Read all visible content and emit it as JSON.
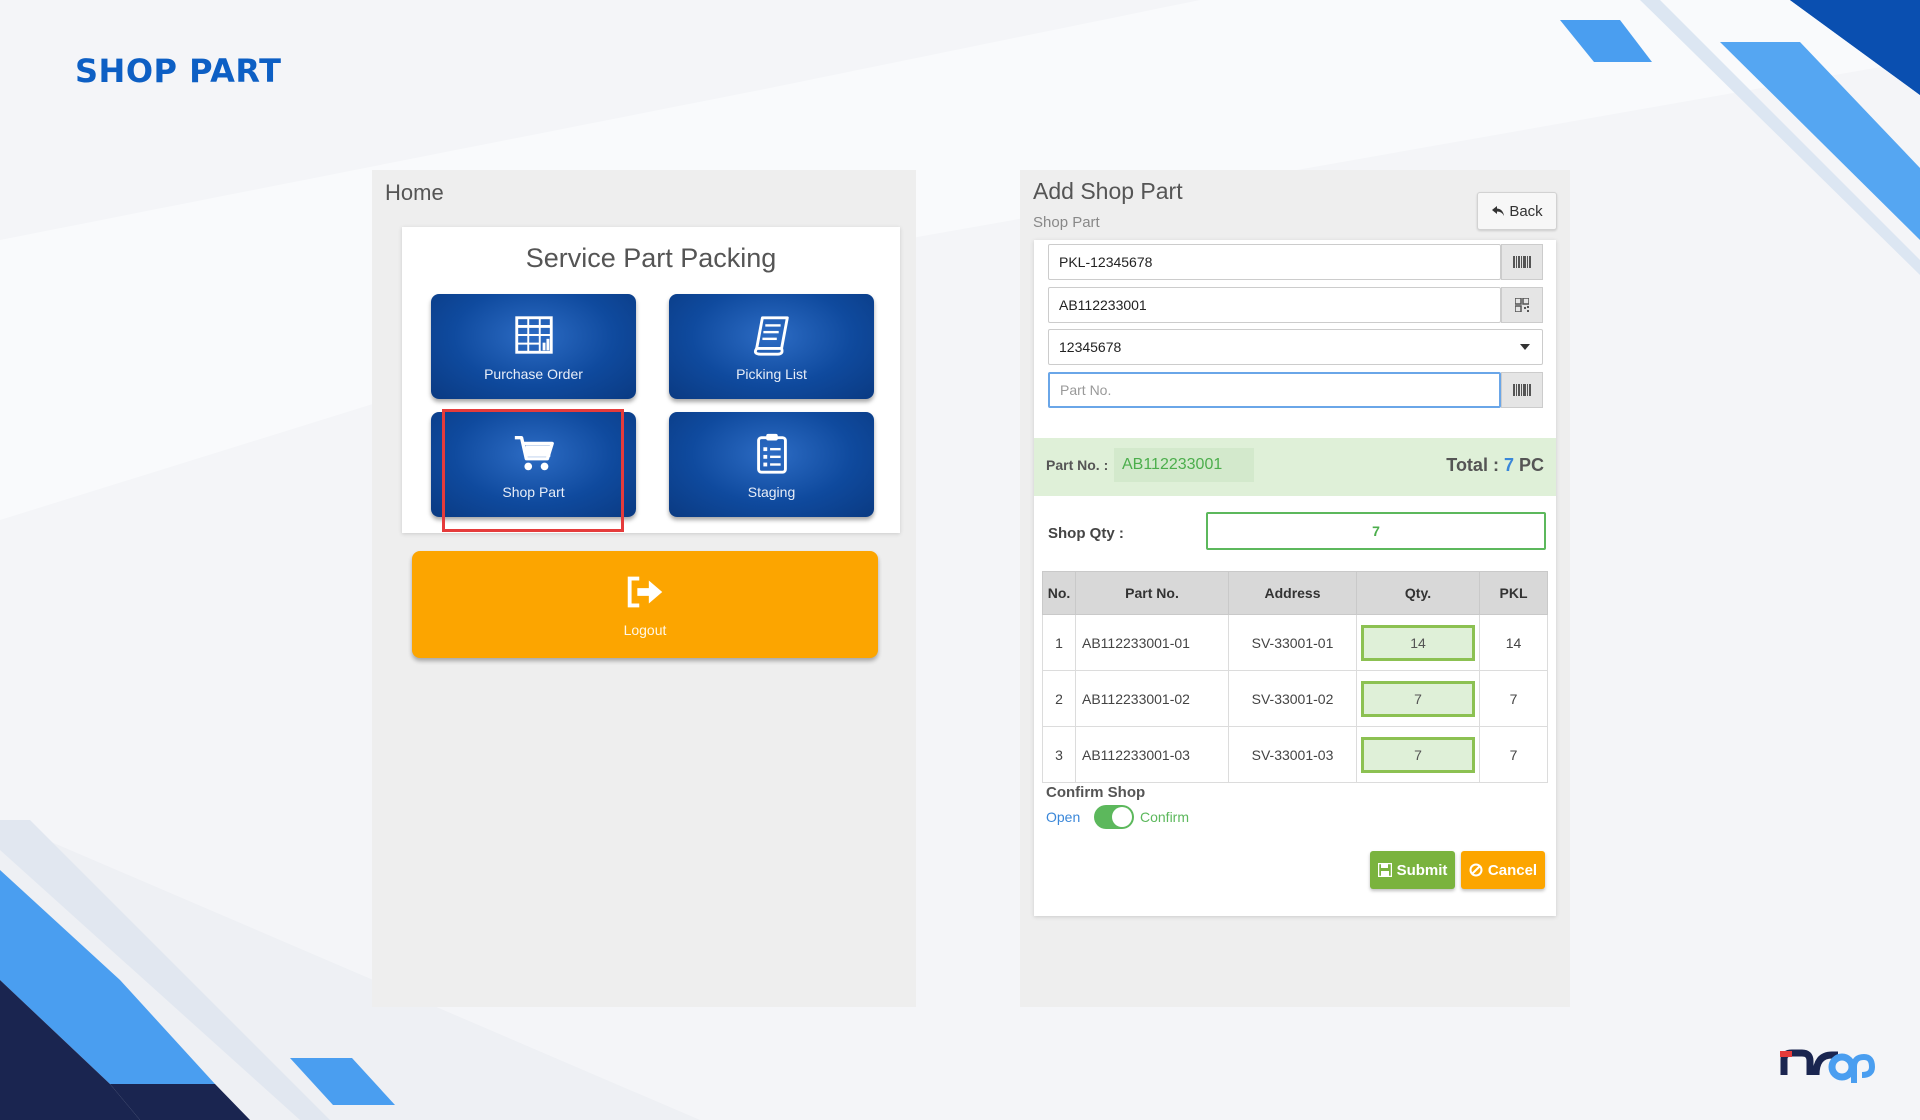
{
  "slide": {
    "title": "SHOP PART",
    "colors": {
      "title": "#0d5fc4",
      "accent_blue": "#0d5fc4",
      "navy": "#1a2550"
    }
  },
  "home": {
    "title": "Home",
    "card_title": "Service Part Packing",
    "tiles": [
      {
        "label": "Purchase Order",
        "icon": "table-chart-icon"
      },
      {
        "label": "Picking List",
        "icon": "scroll-list-icon"
      },
      {
        "label": "Shop Part",
        "icon": "cart-icon"
      },
      {
        "label": "Staging",
        "icon": "clipboard-list-icon"
      }
    ],
    "logout": {
      "label": "Logout",
      "icon": "sign-out-icon"
    },
    "colors": {
      "tile": "#0f4a9e",
      "logout": "#fca500",
      "highlight": "#e53b3b"
    }
  },
  "shop": {
    "title": "Add Shop Part",
    "subtitle": "Shop Part",
    "back_label": "Back",
    "fields": {
      "pkl_value": "PKL-12345678",
      "part_value": "AB112233001",
      "select_value": "12345678",
      "part_no_placeholder": "Part No."
    },
    "summary": {
      "part_label": "Part No. :",
      "part_value": "AB112233001",
      "total_label": "Total :",
      "total_value": "7",
      "total_unit": "PC"
    },
    "shop_qty": {
      "label": "Shop Qty :",
      "value": "7"
    },
    "table": {
      "headers": [
        "No.",
        "Part No.",
        "Address",
        "Qty.",
        "PKL"
      ],
      "rows": [
        [
          "1",
          "AB112233001-01",
          "SV-33001-01",
          "14",
          "14"
        ],
        [
          "2",
          "AB112233001-02",
          "SV-33001-02",
          "7",
          "7"
        ],
        [
          "3",
          "AB112233001-03",
          "SV-33001-03",
          "7",
          "7"
        ]
      ]
    },
    "confirm": {
      "label": "Confirm Shop",
      "off_label": "Open",
      "on_label": "Confirm",
      "checked": true
    },
    "buttons": {
      "submit": "Submit",
      "cancel": "Cancel"
    },
    "colors": {
      "submit": "#7ab33e",
      "cancel": "#fca500",
      "success": "#5cb85c",
      "info": "#3a87d9"
    }
  }
}
